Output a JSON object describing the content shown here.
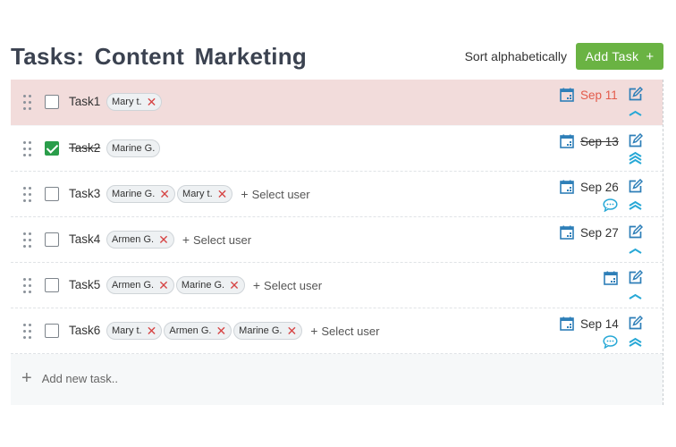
{
  "header": {
    "title": "Tasks:  Content  Marketing",
    "sort_label": "Sort alphabetically",
    "add_task_label": "Add Task",
    "add_task_plus": "+"
  },
  "colors": {
    "accent_green": "#6ab343",
    "overdue_red": "#e35b4b",
    "icon_blue": "#2e7fb8",
    "priority_cyan": "#27a8d6",
    "highlight_row": "#f2dcdb"
  },
  "select_user_label": "Select user",
  "add_new_task_label": "Add new task..",
  "tasks": [
    {
      "name": "Task1",
      "done": false,
      "users": [
        "Mary t."
      ],
      "has_select_user": false,
      "date": "Sep 11",
      "overdue": true,
      "priority": "low",
      "comment": false,
      "highlight": true
    },
    {
      "name": "Task2",
      "done": true,
      "users": [
        "Marine G."
      ],
      "has_select_user": false,
      "date": "Sep 13",
      "overdue": false,
      "priority": "highest",
      "comment": false,
      "highlight": false
    },
    {
      "name": "Task3",
      "done": false,
      "users": [
        "Marine G.",
        "Mary t."
      ],
      "has_select_user": true,
      "date": "Sep 26",
      "overdue": false,
      "priority": "high",
      "comment": true,
      "highlight": false
    },
    {
      "name": "Task4",
      "done": false,
      "users": [
        "Armen G."
      ],
      "has_select_user": true,
      "date": "Sep 27",
      "overdue": false,
      "priority": "low",
      "comment": false,
      "highlight": false
    },
    {
      "name": "Task5",
      "done": false,
      "users": [
        "Armen G.",
        "Marine G."
      ],
      "has_select_user": true,
      "date": "",
      "overdue": false,
      "priority": "low",
      "comment": false,
      "highlight": false
    },
    {
      "name": "Task6",
      "done": false,
      "users": [
        "Mary t.",
        "Armen G.",
        "Marine G."
      ],
      "has_select_user": true,
      "date": "Sep 14",
      "overdue": false,
      "priority": "high",
      "comment": true,
      "highlight": false
    }
  ]
}
